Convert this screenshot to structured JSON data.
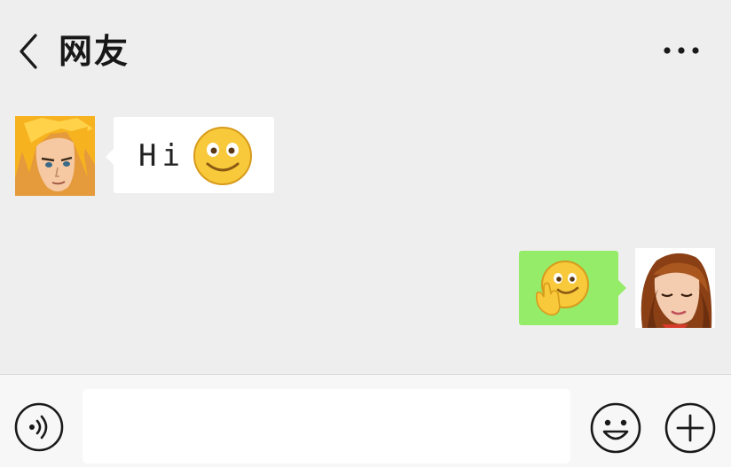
{
  "header": {
    "title": "网友",
    "back_icon": "chevron-left-icon",
    "more_icon": "more-dots-icon"
  },
  "messages": [
    {
      "side": "left",
      "text": "Hi",
      "emoji": "smile-emoji",
      "avatar": "male-cartoon-avatar"
    },
    {
      "side": "right",
      "text": "",
      "emoji": "thinking-hand-emoji",
      "avatar": "female-cartoon-avatar"
    }
  ],
  "input_bar": {
    "value": "",
    "placeholder": "",
    "voice_icon": "voice-icon",
    "emoji_icon": "emoji-face-icon",
    "plus_icon": "plus-circle-icon"
  },
  "colors": {
    "chat_background": "#efeeef",
    "received_bubble": "#ffffff",
    "sent_bubble": "#95ec69",
    "input_bar": "#f7f7f7"
  }
}
